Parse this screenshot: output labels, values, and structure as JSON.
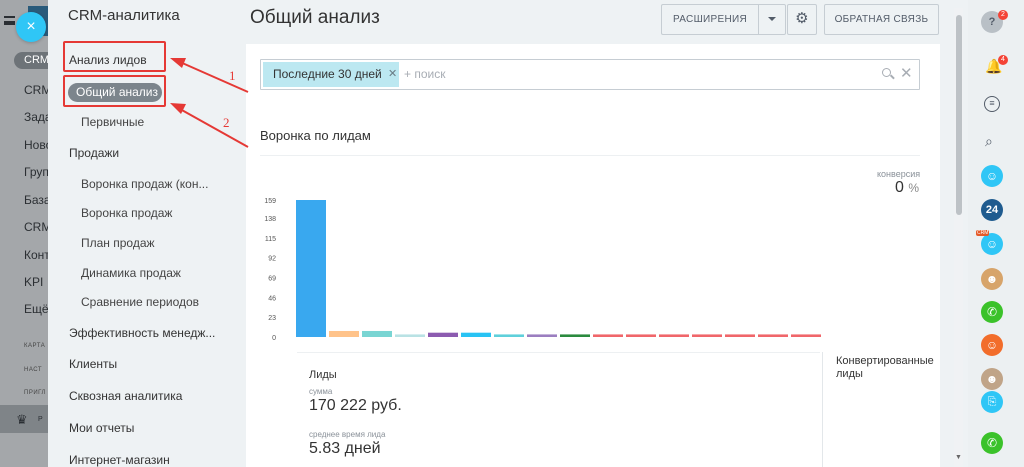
{
  "background_page": {
    "badge": "CRM",
    "items": [
      "CRM",
      "Зада",
      "Ново",
      "Груп",
      "База",
      "CRM",
      "Конт",
      "KPI",
      "Ещё"
    ],
    "small_labels": [
      "КАРТА",
      "НАСТ",
      "ПРИГЛ"
    ],
    "bottom_label": "Р"
  },
  "close_button": "×",
  "sidebar": {
    "title": "CRM-аналитика",
    "items": [
      {
        "label": "Анализ лидов"
      },
      {
        "label": "Общий анализ",
        "active": true
      },
      {
        "label": "Первичные"
      },
      {
        "label": "Продажи"
      },
      {
        "label": "Воронка продаж (кон..."
      },
      {
        "label": "Воронка продаж"
      },
      {
        "label": "План продаж"
      },
      {
        "label": "Динамика продаж"
      },
      {
        "label": "Сравнение периодов"
      },
      {
        "label": "Эффективность менедж..."
      },
      {
        "label": "Клиенты"
      },
      {
        "label": "Сквозная аналитика"
      },
      {
        "label": "Мои отчеты"
      },
      {
        "label": "Интернет-магазин"
      }
    ]
  },
  "header": {
    "title": "Общий анализ",
    "extensions_label": "РАСШИРЕНИЯ",
    "feedback_label": "ОБРАТНАЯ СВЯЗЬ"
  },
  "filter": {
    "chip_label": "Последние 30 дней",
    "search_placeholder": "+ поиск"
  },
  "funnel": {
    "title": "Воронка по лидам",
    "conversion_label": "конверсия",
    "conversion_value": "0",
    "conversion_unit": "%"
  },
  "chart_data": {
    "type": "bar",
    "title": "Воронка по лидам",
    "yticks": [
      0,
      23,
      46,
      69,
      92,
      115,
      138,
      159
    ],
    "ylim": [
      0,
      159
    ],
    "values": [
      159,
      7,
      7,
      3,
      5,
      5,
      3,
      3,
      3,
      3,
      3,
      3,
      3,
      3,
      3,
      3
    ],
    "colors": [
      "#39a8ef",
      "#ffc38a",
      "#79d5d3",
      "#b9e2e4",
      "#8c5bb0",
      "#28c3f4",
      "#5fd0db",
      "#9b7ec0",
      "#2b8a3e",
      "#f0666a",
      "#f0666a",
      "#f0666a",
      "#f0666a",
      "#f0666a",
      "#f0666a",
      "#f0666a"
    ]
  },
  "summary": {
    "leads_label": "Лиды",
    "sum_label": "сумма",
    "sum_value": "170 222 руб.",
    "avg_time_label": "среднее время лида",
    "avg_time_value": "5.83 дней",
    "converted_label": "Конвертированные лиды"
  },
  "annotations": {
    "label_1": "1",
    "label_2": "2",
    "color": "#e53935"
  },
  "rightbar": {
    "help_badge": "2",
    "notifications_badge": "4",
    "crm_tag": "CRM",
    "app_label": "24"
  }
}
